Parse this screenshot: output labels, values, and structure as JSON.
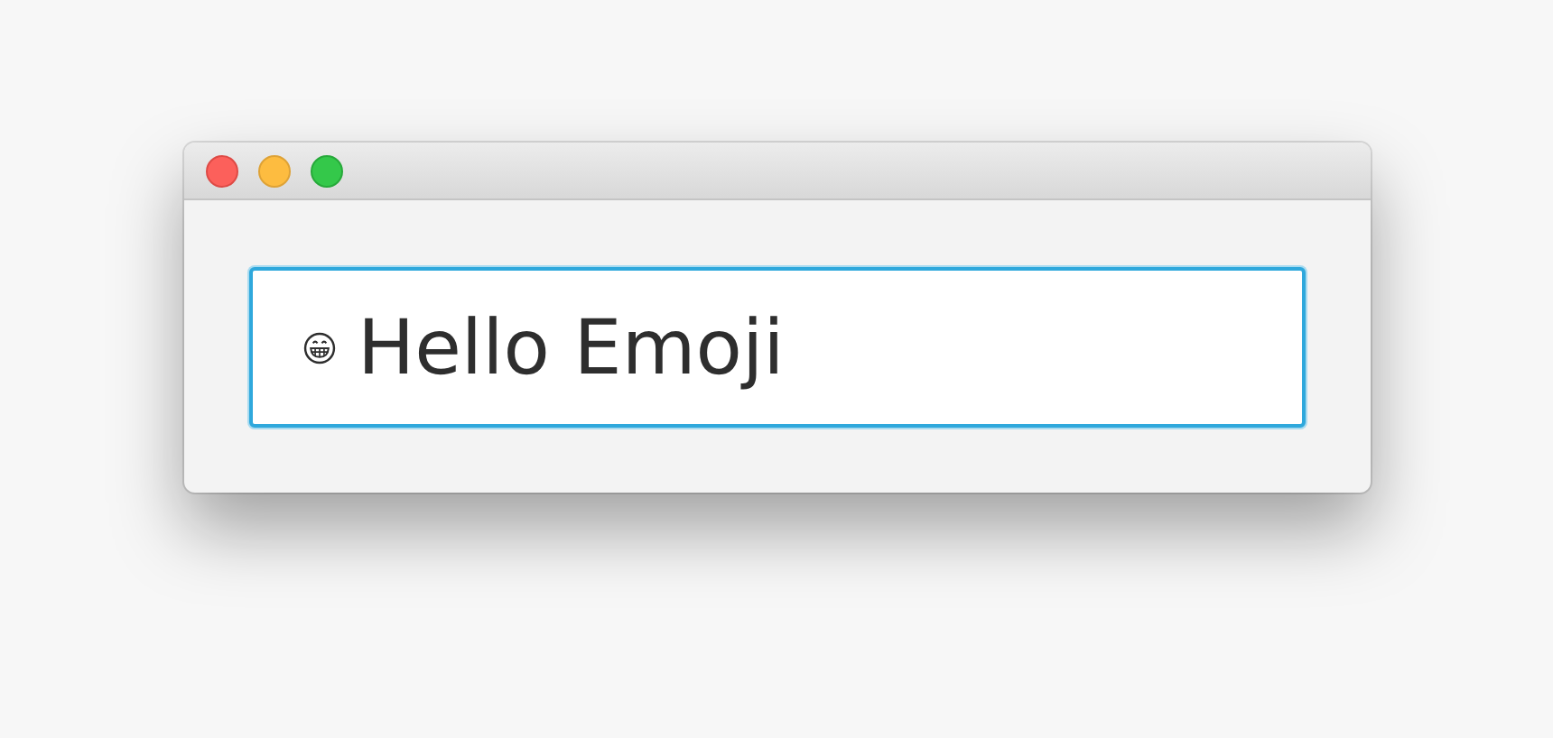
{
  "window": {
    "buttons": [
      {
        "kind": "close"
      },
      {
        "kind": "minimize"
      },
      {
        "kind": "zoom"
      }
    ]
  },
  "text_field": {
    "value": "Hello Emoji",
    "focused": true
  }
}
